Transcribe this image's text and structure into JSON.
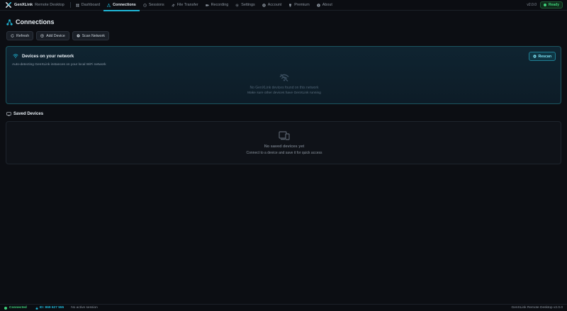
{
  "app": {
    "name": "GenXLink",
    "subtitle": "Remote Desktop",
    "version": "v2.0.0",
    "status": "Ready"
  },
  "nav": [
    {
      "label": "Dashboard",
      "icon": "grid-icon"
    },
    {
      "label": "Connections",
      "icon": "network-icon",
      "active": true
    },
    {
      "label": "Sessions",
      "icon": "clock-icon"
    },
    {
      "label": "File Transfer",
      "icon": "transfer-icon"
    },
    {
      "label": "Recording",
      "icon": "camera-icon"
    },
    {
      "label": "Settings",
      "icon": "gear-icon"
    },
    {
      "label": "Account",
      "icon": "user-icon"
    },
    {
      "label": "Premium",
      "icon": "premium-icon"
    },
    {
      "label": "About",
      "icon": "info-icon"
    }
  ],
  "page": {
    "title": "Connections"
  },
  "actions": {
    "refresh": "Refresh",
    "add_device": "Add Device",
    "scan_network": "Scan Network"
  },
  "network": {
    "title": "Devices on your network",
    "subtitle": "Auto-detecting GenXLink instances on your local WiFi network",
    "rescan": "Rescan",
    "empty_title": "No GenXLink devices found on this network",
    "empty_hint": "Make sure other devices have GenXLink running"
  },
  "saved": {
    "title": "Saved Devices",
    "empty_title": "No saved devices yet",
    "empty_hint": "Connect to a device and save it for quick access"
  },
  "statusbar": {
    "connection": "Connected",
    "id": "ID: 869 627 555",
    "session": "No active session",
    "right": "GenXLink Remote Desktop v2.0.0"
  },
  "colors": {
    "accent": "#1fb6d6",
    "success": "#3fd27a",
    "background": "#0c0e13"
  }
}
